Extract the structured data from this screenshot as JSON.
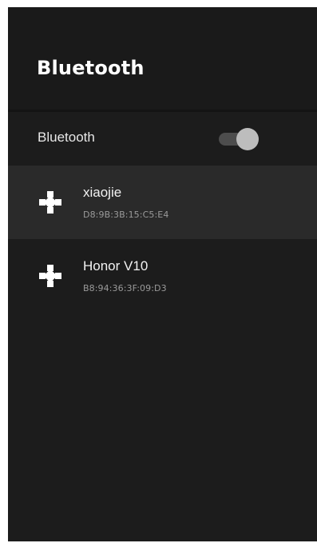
{
  "header": {
    "title": "Bluetooth"
  },
  "bluetooth_toggle": {
    "label": "Bluetooth",
    "state": "on"
  },
  "devices": [
    {
      "name": "xiaojie",
      "address": "D8:9B:3B:15:C5:E4",
      "icon": "gamepad-icon",
      "selected": true
    },
    {
      "name": "Honor V10",
      "address": "B8:94:36:3F:09:D3",
      "icon": "gamepad-icon",
      "selected": false
    }
  ],
  "colors": {
    "background": "#1c1c1c",
    "selected_row": "#2a2a2a",
    "text_primary": "#f2f2f2",
    "text_secondary": "#9a9a9a"
  }
}
